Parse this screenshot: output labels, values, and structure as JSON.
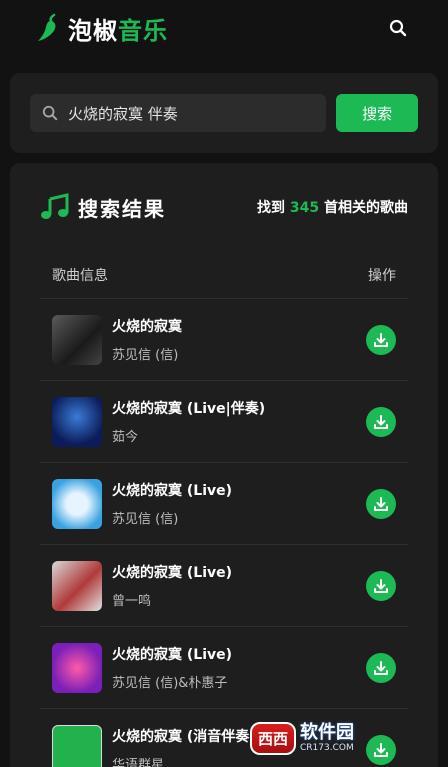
{
  "header": {
    "brand_white": "泡椒",
    "brand_green": "音乐",
    "icons": {
      "logo": "chili-pepper-icon",
      "search": "search-icon"
    }
  },
  "search": {
    "query": "火烧的寂寞 伴奏",
    "button_label": "搜索",
    "icon": "search-icon"
  },
  "results": {
    "title": "搜索结果",
    "count_prefix": "找到",
    "count": "345",
    "count_suffix": "首相关的歌曲",
    "col_info": "歌曲信息",
    "col_action": "操作",
    "icons": {
      "title": "music-note-icon",
      "download": "download-icon"
    },
    "items": [
      {
        "title": "火烧的寂寞",
        "artist": "苏见信 (信)"
      },
      {
        "title": "火烧的寂寞 (Live|伴奏)",
        "artist": "茹今"
      },
      {
        "title": "火烧的寂寞 (Live)",
        "artist": "苏见信 (信)"
      },
      {
        "title": "火烧的寂寞 (Live)",
        "artist": "曾一鸣"
      },
      {
        "title": "火烧的寂寞 (Live)",
        "artist": "苏见信 (信)&朴惠子"
      },
      {
        "title": "火烧的寂寞 (消音伴奏)",
        "artist": "华语群星"
      }
    ]
  },
  "watermark": {
    "badge": "西西",
    "main": "软件园",
    "sub": "CR173.COM"
  },
  "colors": {
    "accent": "#1db954",
    "background": "#121212",
    "card": "#1e1e1e"
  }
}
